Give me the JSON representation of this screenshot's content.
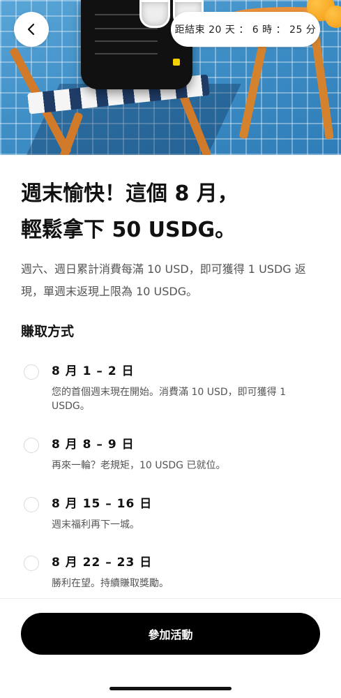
{
  "header": {
    "back_icon": "chevron-left-icon",
    "countdown": "距結束 20 天 ： 6 時 ： 25 分"
  },
  "content": {
    "title_line1": "週末愉快！這個 8 月，",
    "title_line2": "輕鬆拿下 50 USDG。",
    "description": "週六、週日累計消費每滿 10 USD，即可獲得 1 USDG 返現，單週末返現上限為 10 USDG。",
    "section_title": "賺取方式",
    "steps": [
      {
        "date": "8 月 1 – 2 日",
        "text": "您的首個週末現在開始。消費滿 10 USD，即可獲得 1 USDG。"
      },
      {
        "date": "8 月 8 – 9 日",
        "text": "再來一輪？老規矩，10 USDG 已就位。"
      },
      {
        "date": "8 月 15 – 16 日",
        "text": "週末福利再下一城。"
      },
      {
        "date": "8 月 22 – 23 日",
        "text": "勝利在望。持續賺取獎勵。"
      }
    ]
  },
  "footer": {
    "cta_label": "參加活動"
  },
  "colors": {
    "primary_button": "#000000",
    "background": "#ffffff",
    "radio_border": "#d9d9d9"
  }
}
